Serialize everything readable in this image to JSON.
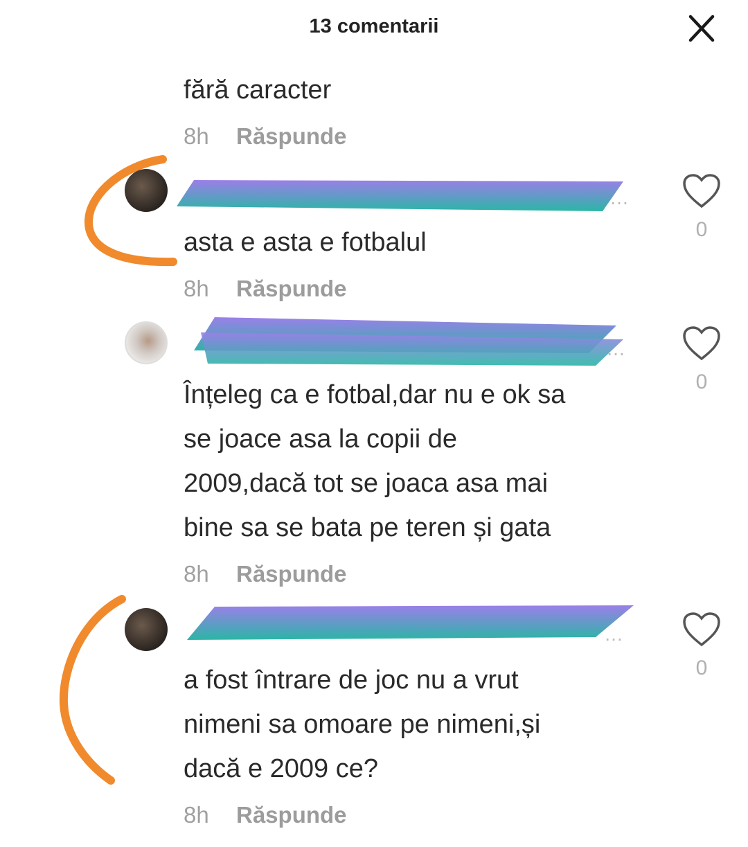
{
  "header": {
    "title": "13 comentarii",
    "close_icon": "close-icon"
  },
  "colors": {
    "accent_scribble_top": "#9b7fe8",
    "accent_scribble_bottom": "#2bb5a6",
    "bracket": "#f08a2c"
  },
  "comments": [
    {
      "text": "fără caracter",
      "time": "8h",
      "reply_label": "Răspunde"
    },
    {
      "text": "asta e asta e fotbalul",
      "time": "8h",
      "reply_label": "Răspunde",
      "likes": "0",
      "username_redacted": true
    },
    {
      "text_lines": [
        "Înțeleg ca e fotbal,dar nu e ok sa",
        "se joace asa la copii de",
        "2009,dacă tot se joaca asa mai",
        "bine sa se bata pe teren și gata"
      ],
      "time": "8h",
      "reply_label": "Răspunde",
      "likes": "0",
      "username_redacted": true
    },
    {
      "text_lines": [
        "a fost întrare de joc nu a vrut",
        "nimeni sa omoare pe nimeni,și",
        "dacă e 2009 ce?"
      ],
      "time": "8h",
      "reply_label": "Răspunde",
      "likes": "0",
      "username_redacted": true
    }
  ]
}
